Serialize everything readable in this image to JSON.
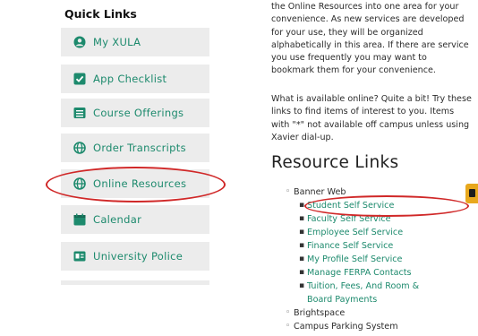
{
  "sidebar": {
    "title": "Quick Links",
    "items": [
      {
        "label": "My XULA",
        "icon": "user-circle-icon"
      },
      {
        "label": "App Checklist",
        "icon": "checkbox-icon"
      },
      {
        "label": "Course Offerings",
        "icon": "list-icon"
      },
      {
        "label": "Order Transcripts",
        "icon": "globe-icon"
      },
      {
        "label": "Online Resources",
        "icon": "globe-icon"
      },
      {
        "label": "Calendar",
        "icon": "calendar-icon"
      },
      {
        "label": "University Police",
        "icon": "id-card-icon"
      }
    ]
  },
  "main": {
    "intro_lines": [
      "the Online Resources into one area for your",
      "convenience. As new services are developed",
      "for your use, they will be organized",
      "alphabetically in this area. If there are service",
      "you use frequently you may want to",
      "bookmark them for your convenience."
    ],
    "available_lines": [
      "What is available online? Quite a bit! Try these",
      "links to find items of interest to you. Items",
      "with \"*\" not available off campus unless using",
      "Xavier dial-up."
    ],
    "heading": "Resource Links",
    "banner_web": "Banner Web",
    "banner_links": [
      "Student Self Service",
      "Faculty Self Service",
      "Employee Self Service",
      "Finance Self Service",
      "My Profile Self Service",
      "Manage FERPA Contacts",
      "Tuition, Fees, And Room &",
      "Board Payments"
    ],
    "other_links": [
      "Brightspace",
      "Campus Parking System"
    ]
  },
  "colors": {
    "accent": "#1d8a6d",
    "highlight_circle": "#d02828",
    "button_bg": "#ececec"
  }
}
